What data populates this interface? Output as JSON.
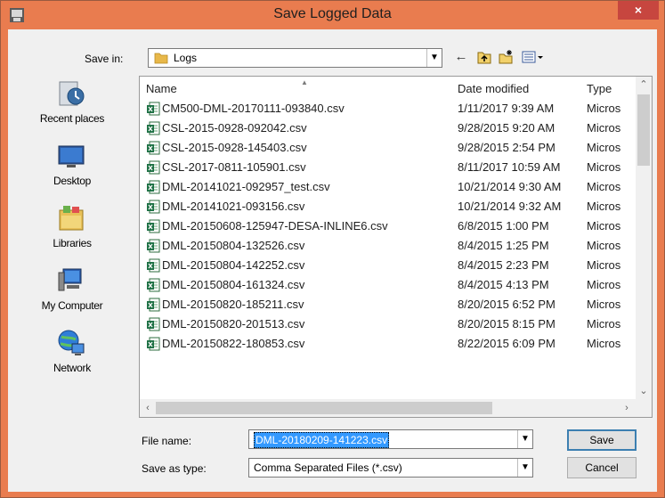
{
  "window": {
    "title": "Save Logged Data",
    "close_label": "×"
  },
  "save_in": {
    "label": "Save in:",
    "value": "Logs"
  },
  "toolbar_icons": [
    "back-arrow-icon",
    "up-folder-icon",
    "new-folder-icon",
    "view-menu-icon"
  ],
  "places": [
    {
      "label": "Recent places",
      "icon": "recent-places-icon"
    },
    {
      "label": "Desktop",
      "icon": "desktop-icon"
    },
    {
      "label": "Libraries",
      "icon": "libraries-icon"
    },
    {
      "label": "My Computer",
      "icon": "computer-icon"
    },
    {
      "label": "Network",
      "icon": "network-icon"
    }
  ],
  "file_list": {
    "columns": {
      "name": "Name",
      "date": "Date modified",
      "type": "Type"
    },
    "rows": [
      {
        "name": "CM500-DML-20170111-093840.csv",
        "date": "1/11/2017 9:39 AM",
        "type": "Micros"
      },
      {
        "name": "CSL-2015-0928-092042.csv",
        "date": "9/28/2015 9:20 AM",
        "type": "Micros"
      },
      {
        "name": "CSL-2015-0928-145403.csv",
        "date": "9/28/2015 2:54 PM",
        "type": "Micros"
      },
      {
        "name": "CSL-2017-0811-105901.csv",
        "date": "8/11/2017 10:59 AM",
        "type": "Micros"
      },
      {
        "name": "DML-20141021-092957_test.csv",
        "date": "10/21/2014 9:30 AM",
        "type": "Micros"
      },
      {
        "name": "DML-20141021-093156.csv",
        "date": "10/21/2014 9:32 AM",
        "type": "Micros"
      },
      {
        "name": "DML-20150608-125947-DESA-INLINE6.csv",
        "date": "6/8/2015 1:00 PM",
        "type": "Micros"
      },
      {
        "name": "DML-20150804-132526.csv",
        "date": "8/4/2015 1:25 PM",
        "type": "Micros"
      },
      {
        "name": "DML-20150804-142252.csv",
        "date": "8/4/2015 2:23 PM",
        "type": "Micros"
      },
      {
        "name": "DML-20150804-161324.csv",
        "date": "8/4/2015 4:13 PM",
        "type": "Micros"
      },
      {
        "name": "DML-20150820-185211.csv",
        "date": "8/20/2015 6:52 PM",
        "type": "Micros"
      },
      {
        "name": "DML-20150820-201513.csv",
        "date": "8/20/2015 8:15 PM",
        "type": "Micros"
      },
      {
        "name": "DML-20150822-180853.csv",
        "date": "8/22/2015 6:09 PM",
        "type": "Micros"
      }
    ]
  },
  "file_name": {
    "label": "File name:",
    "value": "DML-20180209-141223.csv"
  },
  "save_as_type": {
    "label": "Save as type:",
    "value": "Comma Separated Files (*.csv)"
  },
  "buttons": {
    "save": "Save",
    "cancel": "Cancel"
  },
  "colors": {
    "title_bar": "#e97c4f",
    "close_button": "#c7463f",
    "selection": "#3399ff"
  }
}
